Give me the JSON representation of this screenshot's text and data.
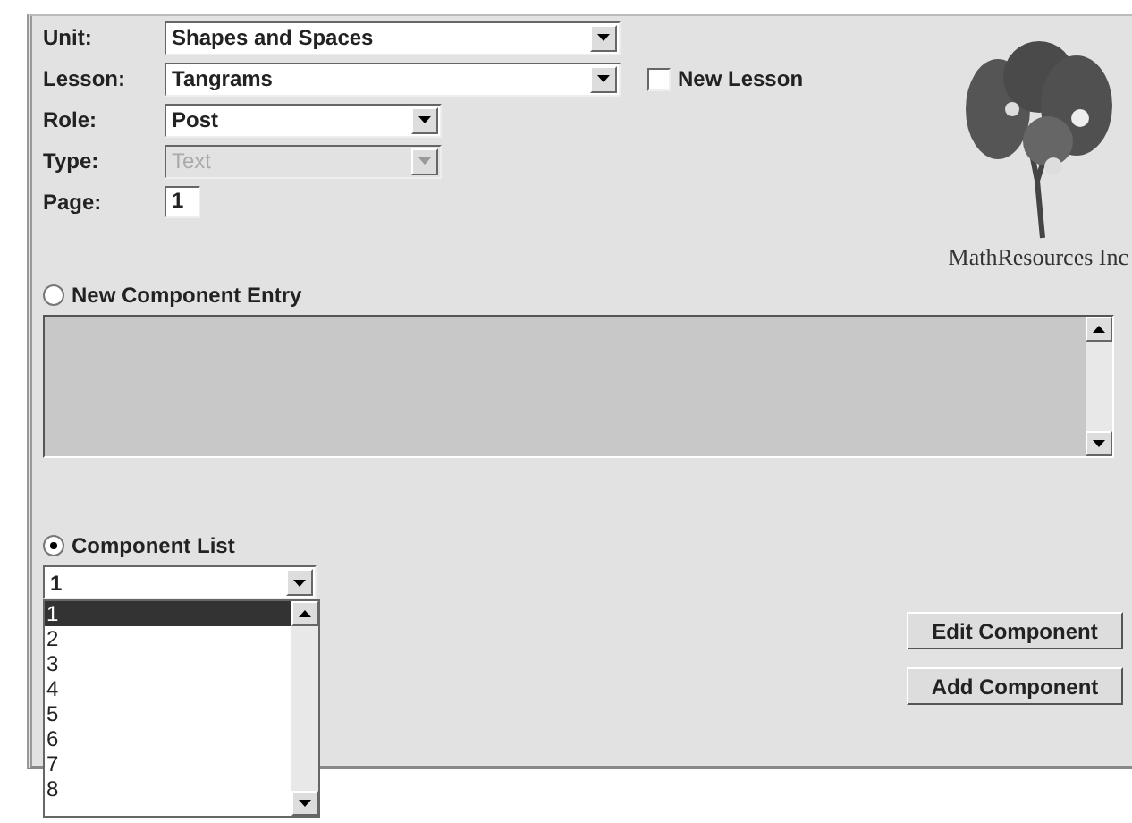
{
  "fields": [
    {
      "label": "Unit:",
      "kind": "combo",
      "value": "Shapes and Spaces",
      "disabled": false
    },
    {
      "label": "Lesson:",
      "kind": "combo",
      "value": "Tangrams",
      "disabled": false
    },
    {
      "label": "Role:",
      "kind": "combo",
      "value": "Post",
      "disabled": false
    },
    {
      "label": "Type:",
      "kind": "combo",
      "value": "Text",
      "disabled": true
    },
    {
      "label": "Page:",
      "kind": "text",
      "value": "1",
      "disabled": false
    }
  ],
  "new_lesson": {
    "label": "New Lesson",
    "checked": false
  },
  "logo": {
    "text": "MathResources Inc"
  },
  "new_component_entry": {
    "label": "New Component Entry",
    "selected": false
  },
  "component_list": {
    "label": "Component List",
    "selected": true,
    "value": "1",
    "items": [
      {
        "label": "1",
        "selected": true
      },
      {
        "label": "2",
        "selected": false
      },
      {
        "label": "3",
        "selected": false
      },
      {
        "label": "4",
        "selected": false
      },
      {
        "label": "5",
        "selected": false
      },
      {
        "label": "6",
        "selected": false
      },
      {
        "label": "7",
        "selected": false
      },
      {
        "label": "8",
        "selected": false
      }
    ]
  },
  "buttons": [
    "Edit Component",
    "Add Component"
  ]
}
